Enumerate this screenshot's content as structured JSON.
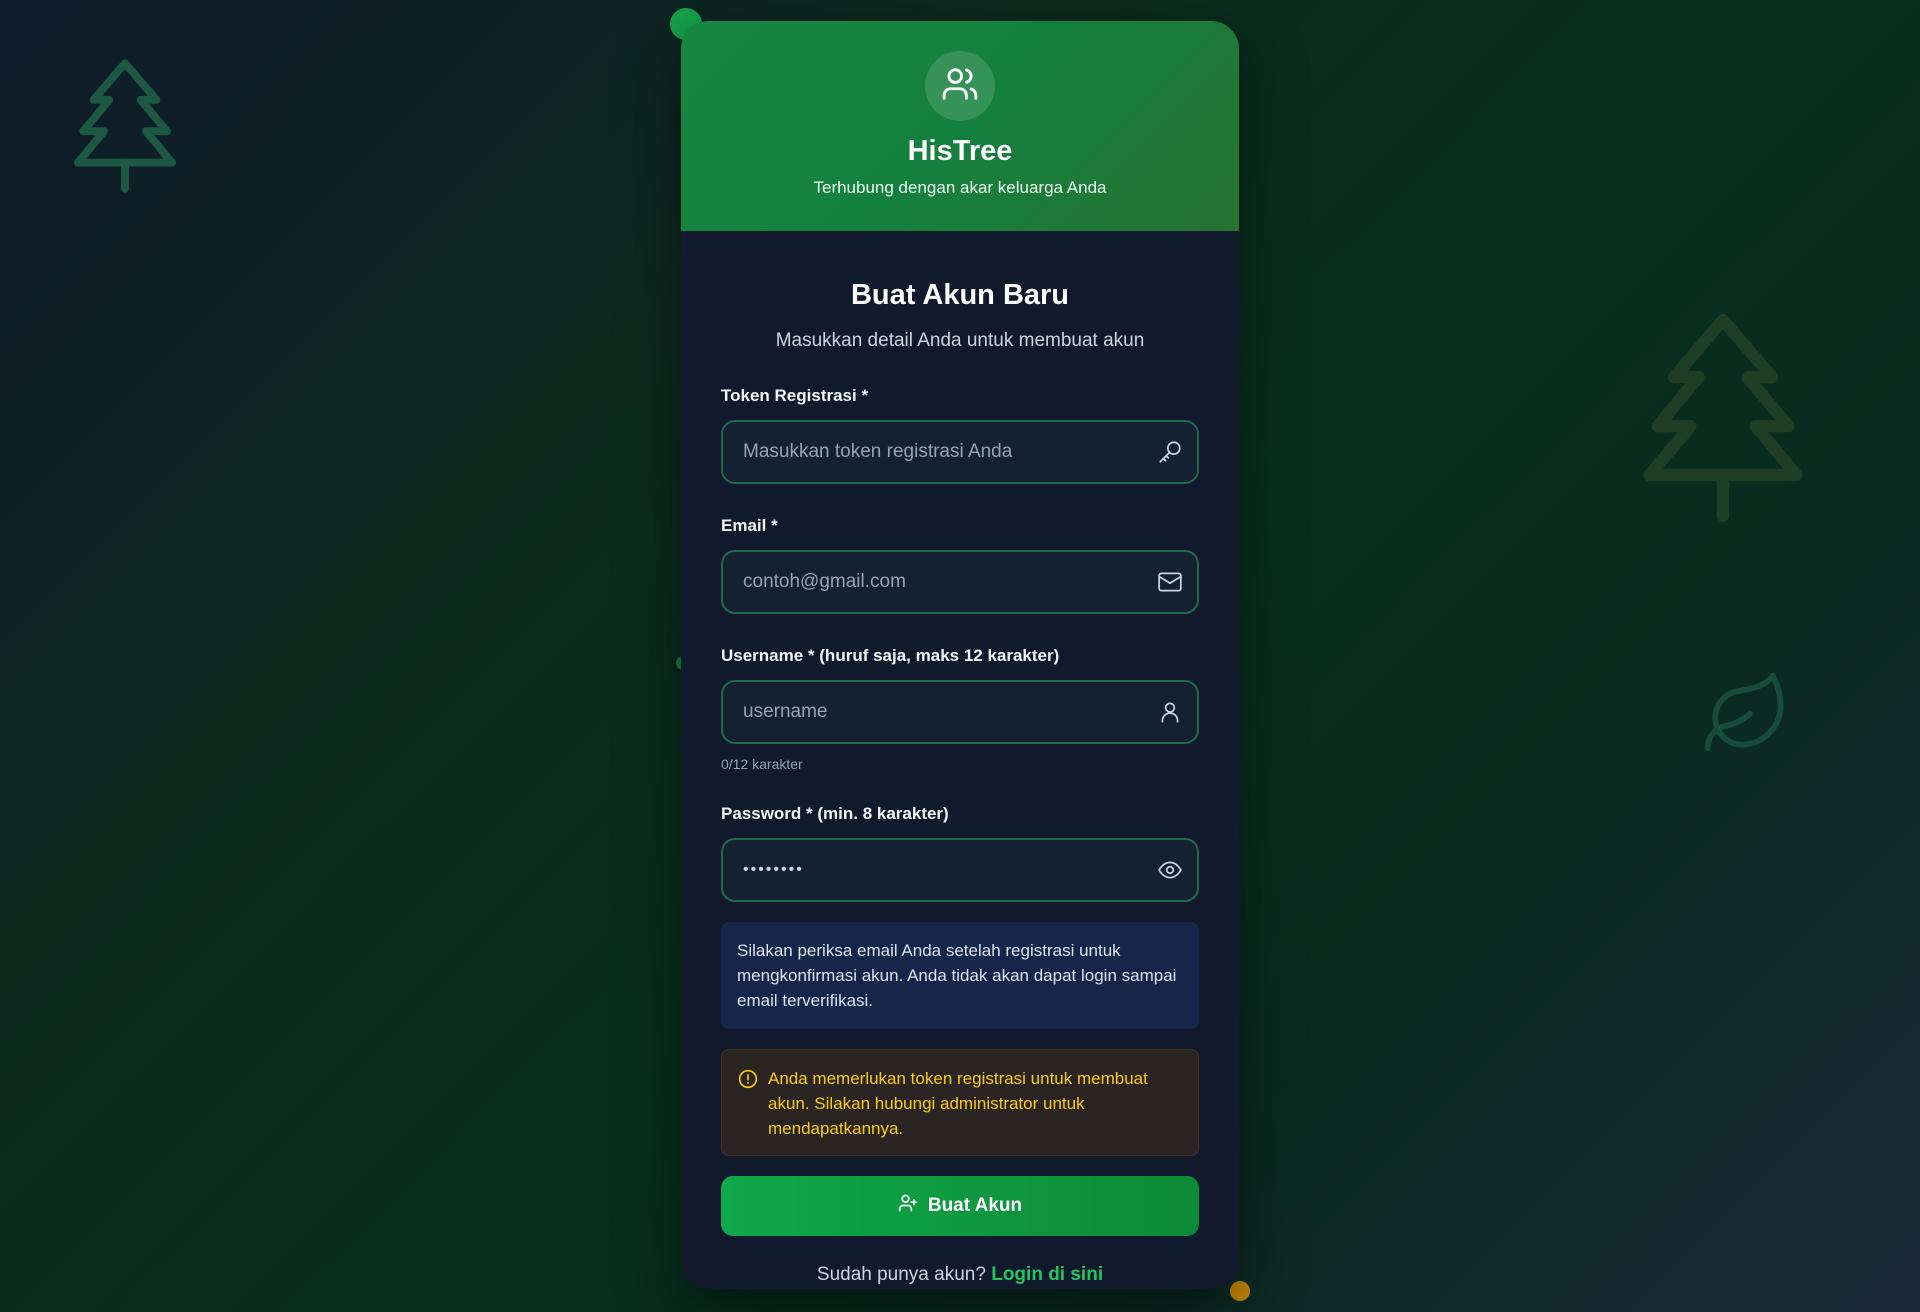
{
  "brand": {
    "name": "HisTree",
    "tagline": "Terhubung dengan akar keluarga Anda",
    "logo_icon": "users-icon"
  },
  "form": {
    "title": "Buat Akun Baru",
    "subtitle": "Masukkan detail Anda untuk membuat akun",
    "token": {
      "label": "Token Registrasi *",
      "placeholder": "Masukkan token registrasi Anda",
      "value": "",
      "icon": "key-icon"
    },
    "email": {
      "label": "Email *",
      "placeholder": "contoh@gmail.com",
      "value": "",
      "icon": "mail-icon"
    },
    "username": {
      "label": "Username * (huruf saja, maks 12 karakter)",
      "placeholder": "username",
      "value": "",
      "helper": "0/12 karakter",
      "icon": "user-icon"
    },
    "password": {
      "label": "Password * (min. 8 karakter)",
      "masked_value": "••••••••",
      "icon": "eye-icon"
    },
    "info_message": "Silakan periksa email Anda setelah registrasi untuk mengkonfirmasi akun. Anda tidak akan dapat login sampai email terverifikasi.",
    "warning_message": "Anda memerlukan token registrasi untuk membuat akun. Silakan hubungi administrator untuk mendapatkannya.",
    "submit_label": "Buat Akun",
    "footer_text": "Sudah punya akun?",
    "login_link": "Login di sini"
  },
  "colors": {
    "accent": "#16a34a",
    "header_green": "#178640",
    "card_bg": "#101a2c",
    "warning": "#facc15",
    "link": "#22c55e"
  }
}
